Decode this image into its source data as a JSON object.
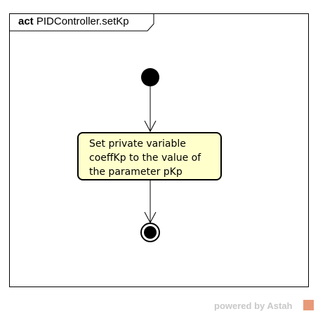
{
  "frame": {
    "keyword": "act",
    "name": "PIDController.setKp"
  },
  "action": {
    "label": "Set private variable\ncoeffKp to the value of\nthe parameter pKp"
  },
  "footer": {
    "watermark": "powered by Astah"
  },
  "colors": {
    "action_fill": "#ffffcc",
    "stroke": "#000000",
    "watermark": "#c8c8c8",
    "logo": "#e89a78"
  }
}
